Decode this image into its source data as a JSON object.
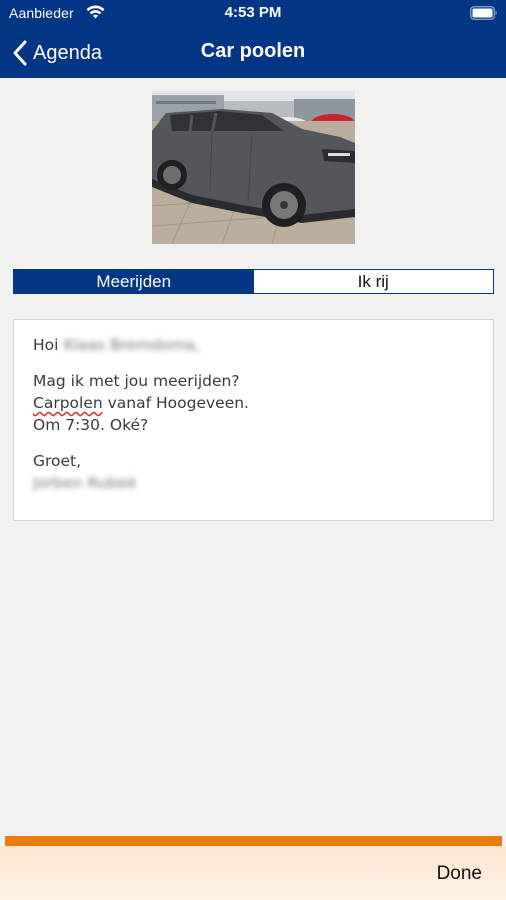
{
  "status_bar": {
    "carrier": "Aanbieder",
    "time": "4:53 PM",
    "wifi_icon": "wifi-icon",
    "battery_icon": "battery-icon"
  },
  "nav": {
    "back_label": "Agenda",
    "back_icon": "chevron-left-icon",
    "title": "Car poolen"
  },
  "photo": {
    "subject": "car-photo"
  },
  "segmented": {
    "options": [
      "Meerijden",
      "Ik rij"
    ],
    "selected": "Meerijden"
  },
  "message": {
    "greeting": "Hoi",
    "recipient": "Klaas Bremdoma,",
    "line1": "Mag ik met jou meerijden?",
    "line2_word": "Carpolen",
    "line2_rest": " vanaf Hoogeveen.",
    "line3": "Om 7:30. Oké?",
    "closing": "Groet,",
    "sender": "Jorben Rubeé"
  },
  "footer": {
    "done_label": "Done"
  },
  "colors": {
    "brand_navy": "#053585",
    "accent_orange": "#e97b12",
    "background": "#f1f1ef"
  }
}
